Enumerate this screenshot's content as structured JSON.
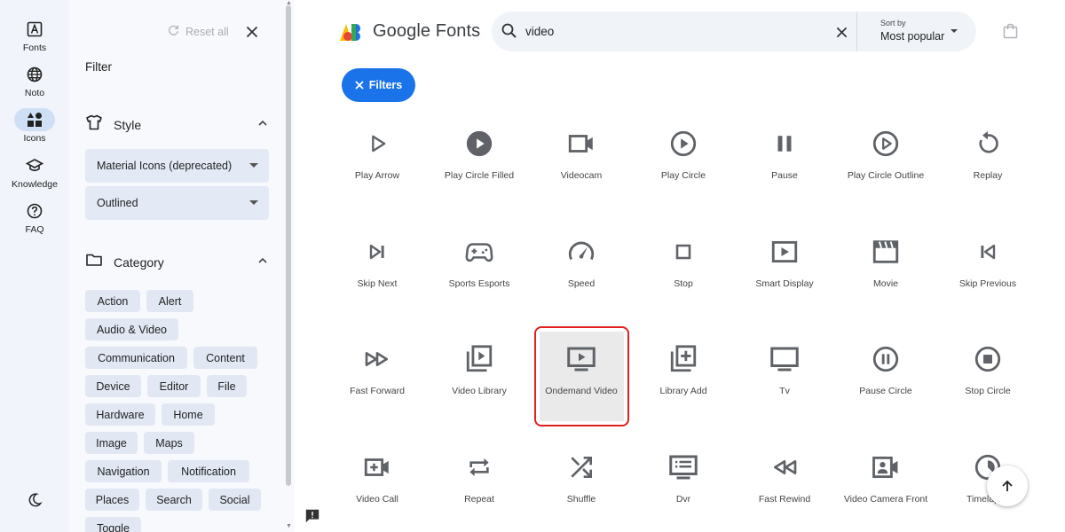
{
  "rail": {
    "items": [
      {
        "label": "Fonts"
      },
      {
        "label": "Noto"
      },
      {
        "label": "Icons"
      },
      {
        "label": "Knowledge"
      },
      {
        "label": "FAQ"
      }
    ]
  },
  "panel": {
    "reset_label": "Reset all",
    "title": "Filter",
    "style_section": {
      "label": "Style",
      "select_family": "Material Icons (deprecated)",
      "select_style": "Outlined"
    },
    "category_section": {
      "label": "Category",
      "chips": [
        "Action",
        "Alert",
        "Audio & Video",
        "Communication",
        "Content",
        "Device",
        "Editor",
        "File",
        "Hardware",
        "Home",
        "Image",
        "Maps",
        "Navigation",
        "Notification",
        "Places",
        "Search",
        "Social",
        "Toggle"
      ]
    }
  },
  "header": {
    "logo_text": "Google Fonts",
    "search_value": "video",
    "sort_label": "Sort by",
    "sort_value": "Most popular"
  },
  "filters_button": "Filters",
  "icons": [
    {
      "name": "Play Arrow",
      "icon": "play-arrow-icon"
    },
    {
      "name": "Play Circle Filled",
      "icon": "play-circle-filled-icon"
    },
    {
      "name": "Videocam",
      "icon": "videocam-icon"
    },
    {
      "name": "Play Circle",
      "icon": "play-circle-icon"
    },
    {
      "name": "Pause",
      "icon": "pause-icon"
    },
    {
      "name": "Play Circle Outline",
      "icon": "play-circle-outline-icon"
    },
    {
      "name": "Replay",
      "icon": "replay-icon"
    },
    {
      "name": "Skip Next",
      "icon": "skip-next-icon"
    },
    {
      "name": "Sports Esports",
      "icon": "sports-esports-icon"
    },
    {
      "name": "Speed",
      "icon": "speed-icon"
    },
    {
      "name": "Stop",
      "icon": "stop-icon"
    },
    {
      "name": "Smart Display",
      "icon": "smart-display-icon"
    },
    {
      "name": "Movie",
      "icon": "movie-icon"
    },
    {
      "name": "Skip Previous",
      "icon": "skip-previous-icon"
    },
    {
      "name": "Fast Forward",
      "icon": "fast-forward-icon"
    },
    {
      "name": "Video Library",
      "icon": "video-library-icon"
    },
    {
      "name": "Ondemand Video",
      "icon": "ondemand-video-icon"
    },
    {
      "name": "Library Add",
      "icon": "library-add-icon"
    },
    {
      "name": "Tv",
      "icon": "tv-icon"
    },
    {
      "name": "Pause Circle",
      "icon": "pause-circle-icon"
    },
    {
      "name": "Stop Circle",
      "icon": "stop-circle-icon"
    },
    {
      "name": "Video Call",
      "icon": "video-call-icon"
    },
    {
      "name": "Repeat",
      "icon": "repeat-icon"
    },
    {
      "name": "Shuffle",
      "icon": "shuffle-icon"
    },
    {
      "name": "Dvr",
      "icon": "dvr-icon"
    },
    {
      "name": "Fast Rewind",
      "icon": "fast-rewind-icon"
    },
    {
      "name": "Video Camera Front",
      "icon": "video-camera-front-icon"
    },
    {
      "name": "Timelapse",
      "icon": "timelapse-icon"
    }
  ],
  "colors": {
    "accent": "#1a73e8",
    "icon": "#5f6368",
    "highlight_border": "#e02020"
  }
}
